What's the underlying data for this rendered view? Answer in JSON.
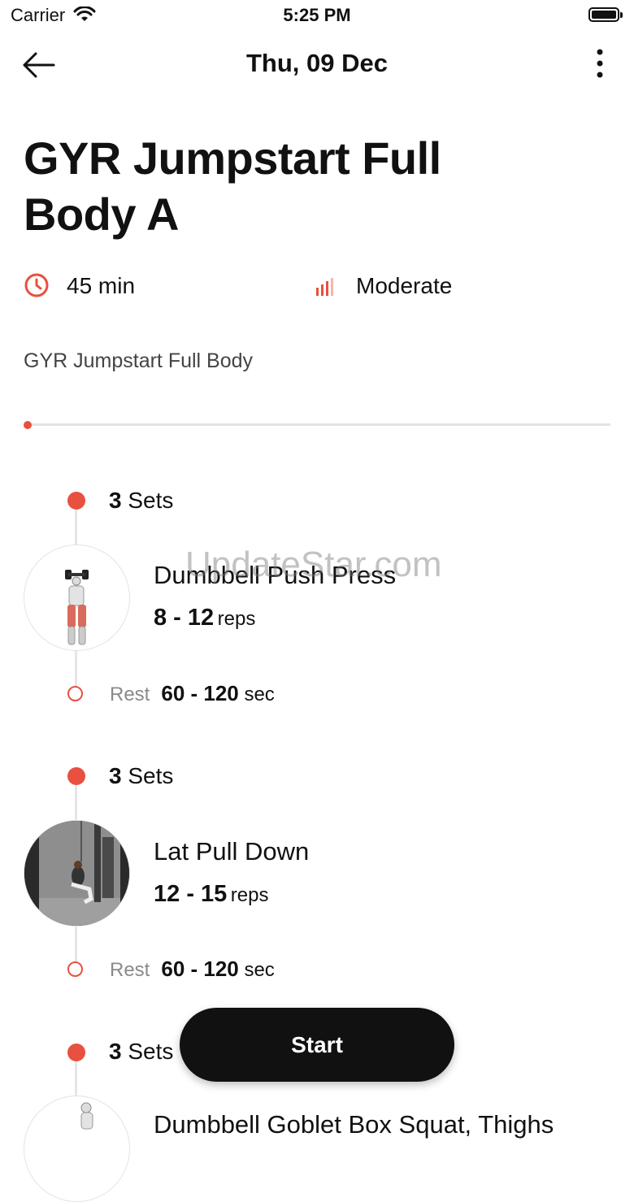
{
  "status_bar": {
    "carrier": "Carrier",
    "time": "5:25 PM"
  },
  "header": {
    "title": "Thu, 09 Dec",
    "back_icon": "arrow-left-icon",
    "more_icon": "more-vertical-icon"
  },
  "workout": {
    "title": "GYR Jumpstart Full Body A",
    "duration": "45 min",
    "intensity": "Moderate",
    "description": "GYR Jumpstart Full Body",
    "progress_fraction": 0
  },
  "exercises": [
    {
      "sets_count": "3",
      "sets_label": "Sets",
      "name": "Dumbbell Push Press",
      "reps": "8 - 12",
      "reps_unit": "reps",
      "rest_label": "Rest",
      "rest": "60 - 120",
      "rest_unit": "sec"
    },
    {
      "sets_count": "3",
      "sets_label": "Sets",
      "name": "Lat Pull Down",
      "reps": "12 - 15",
      "reps_unit": "reps",
      "rest_label": "Rest",
      "rest": "60 - 120",
      "rest_unit": "sec"
    },
    {
      "sets_count": "3",
      "sets_label": "Sets",
      "name": "Dumbbell Goblet Box Squat, Thighs"
    }
  ],
  "start_button": "Start",
  "watermark": "UpdateStar.com",
  "colors": {
    "accent": "#e8503f",
    "button": "#111111"
  }
}
